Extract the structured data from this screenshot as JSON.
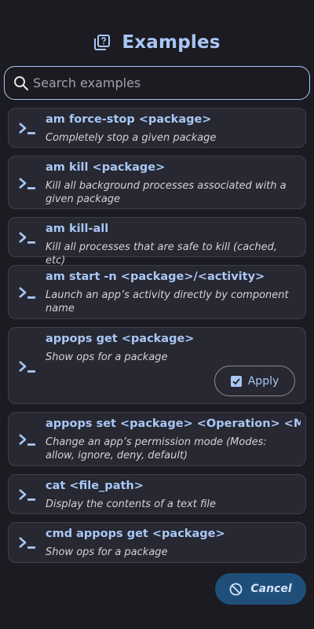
{
  "colors": {
    "background": "#1c1b22",
    "card": "#272832",
    "accent": "#a9c7f5",
    "cancel_button": "#1f4f79"
  },
  "header": {
    "icon": "library-icon",
    "title": "Examples"
  },
  "search": {
    "icon": "search-icon",
    "placeholder": "Search examples",
    "value": ""
  },
  "examples": [
    {
      "title": "am force-stop <package>",
      "description": "Completely stop a given package"
    },
    {
      "title": "am kill <package>",
      "description": "Kill all background processes associated with a given package"
    },
    {
      "title": "am kill-all",
      "description": "Kill all processes that are safe to kill (cached, etc)"
    },
    {
      "title": "am start -n <package>/<activity>",
      "description": "Launch an app’s activity directly by component name"
    },
    {
      "title": "appops get <package>",
      "description": "Show ops for a package",
      "apply_label": "Apply",
      "expanded": true
    },
    {
      "title": "appops set <package> <Operation> <Mode>",
      "description": "Change an app’s permission mode (Modes: allow, ignore, deny, default)"
    },
    {
      "title": "cat <file_path>",
      "description": "Display the contents of a text file"
    },
    {
      "title": "cmd appops get <package>",
      "description": "Show ops for a package"
    }
  ],
  "footer": {
    "cancel_label": "Cancel",
    "cancel_icon": "block-icon"
  }
}
